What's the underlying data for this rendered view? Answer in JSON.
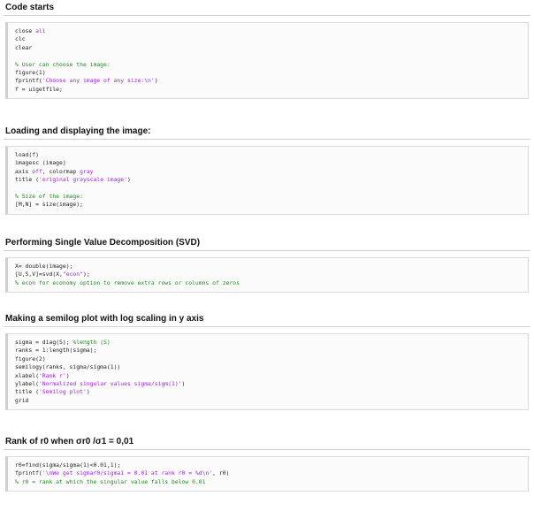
{
  "sections": [
    {
      "heading": "Code starts",
      "lines": [
        [
          {
            "t": "close ",
            "c": "plain"
          },
          {
            "t": "all",
            "c": "kw"
          }
        ],
        [
          {
            "t": "clc",
            "c": "plain"
          }
        ],
        [
          {
            "t": "clear",
            "c": "plain"
          }
        ],
        [
          {
            "t": "",
            "c": "plain"
          }
        ],
        [
          {
            "t": "% User can choose the image:",
            "c": "cm"
          }
        ],
        [
          {
            "t": "figure(1)",
            "c": "plain"
          }
        ],
        [
          {
            "t": "fprintf(",
            "c": "plain"
          },
          {
            "t": "'Choose any image of any size:\\n'",
            "c": "str"
          },
          {
            "t": ")",
            "c": "plain"
          }
        ],
        [
          {
            "t": "f = uigetfile;",
            "c": "plain"
          }
        ]
      ]
    },
    {
      "heading": "Loading and displaying the image:",
      "lines": [
        [
          {
            "t": "load(f)",
            "c": "plain"
          }
        ],
        [
          {
            "t": "imagesc (image)",
            "c": "plain"
          }
        ],
        [
          {
            "t": "axis ",
            "c": "plain"
          },
          {
            "t": "off",
            "c": "kw"
          },
          {
            "t": ", colormap ",
            "c": "plain"
          },
          {
            "t": "gray",
            "c": "kw"
          }
        ],
        [
          {
            "t": "title (",
            "c": "plain"
          },
          {
            "t": "'original grayscale image'",
            "c": "str"
          },
          {
            "t": ")",
            "c": "plain"
          }
        ],
        [
          {
            "t": "",
            "c": "plain"
          }
        ],
        [
          {
            "t": "% Size of the image:",
            "c": "cm"
          }
        ],
        [
          {
            "t": "[M,N] = size(image);",
            "c": "plain"
          }
        ]
      ]
    },
    {
      "heading": "Performing Single Value Decomposition (SVD)",
      "lines": [
        [
          {
            "t": "X= double(image);",
            "c": "plain"
          }
        ],
        [
          {
            "t": "[U,S,V]=svd(X,",
            "c": "plain"
          },
          {
            "t": "\"econ\"",
            "c": "str"
          },
          {
            "t": ");",
            "c": "plain"
          }
        ],
        [
          {
            "t": "% econ for economy option to remove extra rows or columns of zeros",
            "c": "cm"
          }
        ]
      ]
    },
    {
      "heading": "Making a semilog plot with log scaling in y axis",
      "lines": [
        [
          {
            "t": "sigma = diag(S); ",
            "c": "plain"
          },
          {
            "t": "%length (S)",
            "c": "cm"
          }
        ],
        [
          {
            "t": "ranks = 1:length(sigma);",
            "c": "plain"
          }
        ],
        [
          {
            "t": "figure(2)",
            "c": "plain"
          }
        ],
        [
          {
            "t": "semilogy(ranks, sigma/sigma(1))",
            "c": "plain"
          }
        ],
        [
          {
            "t": "xlabel(",
            "c": "plain"
          },
          {
            "t": "'Rank r'",
            "c": "str"
          },
          {
            "t": ")",
            "c": "plain"
          }
        ],
        [
          {
            "t": "ylabel(",
            "c": "plain"
          },
          {
            "t": "'Normalized singular values sigma/sigm(1)'",
            "c": "str"
          },
          {
            "t": ")",
            "c": "plain"
          }
        ],
        [
          {
            "t": "title (",
            "c": "plain"
          },
          {
            "t": "'Semilog plot'",
            "c": "str"
          },
          {
            "t": ")",
            "c": "plain"
          }
        ],
        [
          {
            "t": "grid",
            "c": "plain"
          }
        ]
      ]
    },
    {
      "heading": "Rank of r0 when σr0 /σ1 = 0,01",
      "lines": [
        [
          {
            "t": "r0=find(sigma/sigma(1)<0.01,1);",
            "c": "plain"
          }
        ],
        [
          {
            "t": "fprintf(",
            "c": "plain"
          },
          {
            "t": "'\\nWe get sigmar0/sigma1 = 0.01 at rank r0 = %d\\n'",
            "c": "str"
          },
          {
            "t": ", r0)",
            "c": "plain"
          }
        ],
        [
          {
            "t": "% r0 = rank at which the singular value falls below 0.01",
            "c": "cm"
          }
        ]
      ]
    }
  ]
}
